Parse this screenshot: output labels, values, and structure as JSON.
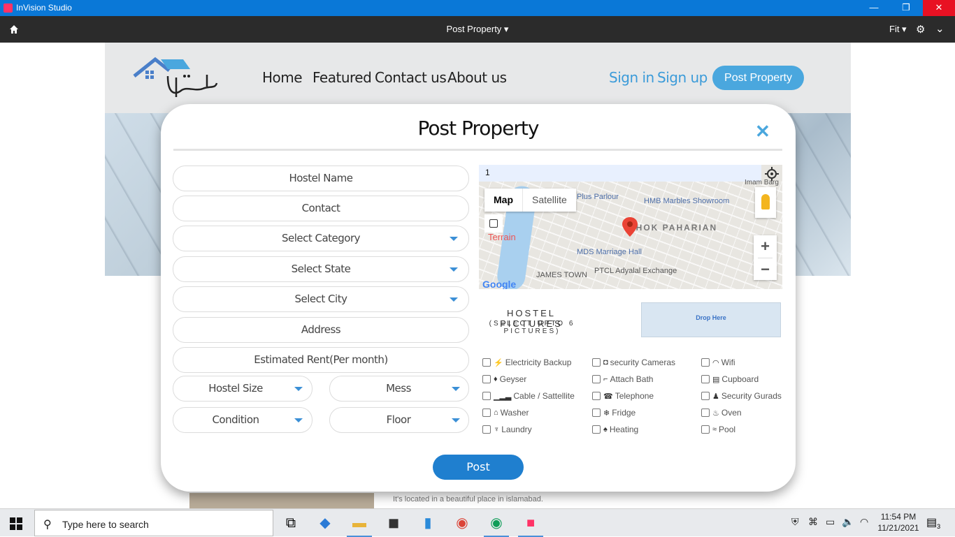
{
  "window": {
    "app_title": "InVision Studio",
    "min": "—",
    "max": "❐",
    "close": "✕"
  },
  "toolbar": {
    "document_title": "Post Property ▾",
    "zoom": "Fit ▾",
    "settings_icon": "gear-icon",
    "account_icon": "chevron-down-icon"
  },
  "site": {
    "nav": [
      "Home",
      "Featured",
      "Contact us",
      "About us"
    ],
    "sign_in": "Sign in",
    "sign_up": "Sign up",
    "post_property": "Post Property",
    "bg_text": "It's located in a beautiful place in islamabad."
  },
  "modal": {
    "title": "Post Property",
    "close": "✕",
    "fields": {
      "hostel_name": "Hostel Name",
      "contact": "Contact",
      "category": "Select Category",
      "state": "Select State",
      "city": "Select City",
      "address": "Address",
      "rent": "Estimated Rent(Per month)",
      "hostel_size": "Hostel Size",
      "mess": "Mess",
      "condition": "Condition",
      "floor": "Floor"
    },
    "map": {
      "search_value": "1",
      "map_tab": "Map",
      "satellite_tab": "Satellite",
      "terrain": "Terrain",
      "labels": [
        "Plus Parlour",
        "HMB Marbles Showroom",
        "DHOK PAHARIAN",
        "MDS Marriage Hall",
        "PTCL Adyalal Exchange",
        "JAMES TOWN",
        "Imam Barg"
      ],
      "zoom_in": "+",
      "zoom_out": "−",
      "google": "Google"
    },
    "pictures": {
      "title": "HOSTEL PICTURES",
      "subtitle": "(SELECT UPTO 6 PICTURES)",
      "drop": "Drop Here"
    },
    "amenities": [
      [
        "Electricity Backup",
        "security Cameras",
        "Wifi"
      ],
      [
        "Geyser",
        "Attach Bath",
        "Cupboard"
      ],
      [
        "Cable / Sattellite",
        "Telephone",
        "Security Gurads"
      ],
      [
        "Washer",
        "Fridge",
        "Oven"
      ],
      [
        "Laundry",
        "Heating",
        "Pool"
      ]
    ],
    "post_button": "Post"
  },
  "taskbar": {
    "search_placeholder": "Type here to search",
    "time": "11:54 PM",
    "date": "11/21/2021",
    "notifications": "3"
  }
}
